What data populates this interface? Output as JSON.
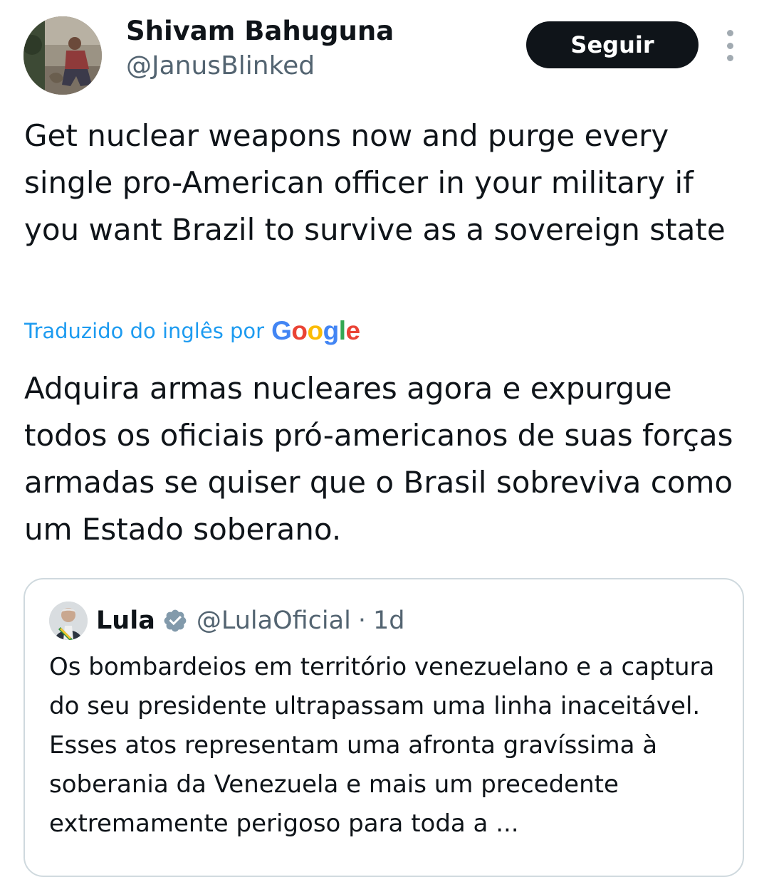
{
  "tweet": {
    "author": {
      "display_name": "Shivam Bahuguna",
      "handle": "@JanusBlinked",
      "avatar_icon": "user-avatar-photo"
    },
    "follow_label": "Seguir",
    "more_icon": "more-vertical-icon",
    "text": "Get nuclear weapons now and purge every single pro-American officer in your military if you want Brazil to survive as a sovereign state",
    "translation": {
      "label": "Traduzido do inglês por",
      "provider": "Google",
      "text": "Adquira armas nucleares agora e expurgue todos os oficiais pró-americanos de suas forças armadas se quiser que o Brasil sobreviva como um Estado soberano."
    }
  },
  "quoted_tweet": {
    "display_name": "Lula",
    "verified_icon": "verified-badge-icon",
    "handle": "@LulaOficial",
    "separator": "·",
    "time": "1d",
    "text": "Os bombardeios em território venezuelano e a captura do seu presidente ultrapassam uma linha inaceitável. Esses atos representam uma afronta gravíssima à soberania da Venezuela e mais um precedente extremamente perigoso para toda a ..."
  },
  "colors": {
    "text_primary": "#0f1419",
    "text_secondary": "#536471",
    "link_blue": "#1d9bf0",
    "follow_button_bg": "#0f1419",
    "border": "#cfd9de",
    "verified_badge": "#829aab"
  }
}
